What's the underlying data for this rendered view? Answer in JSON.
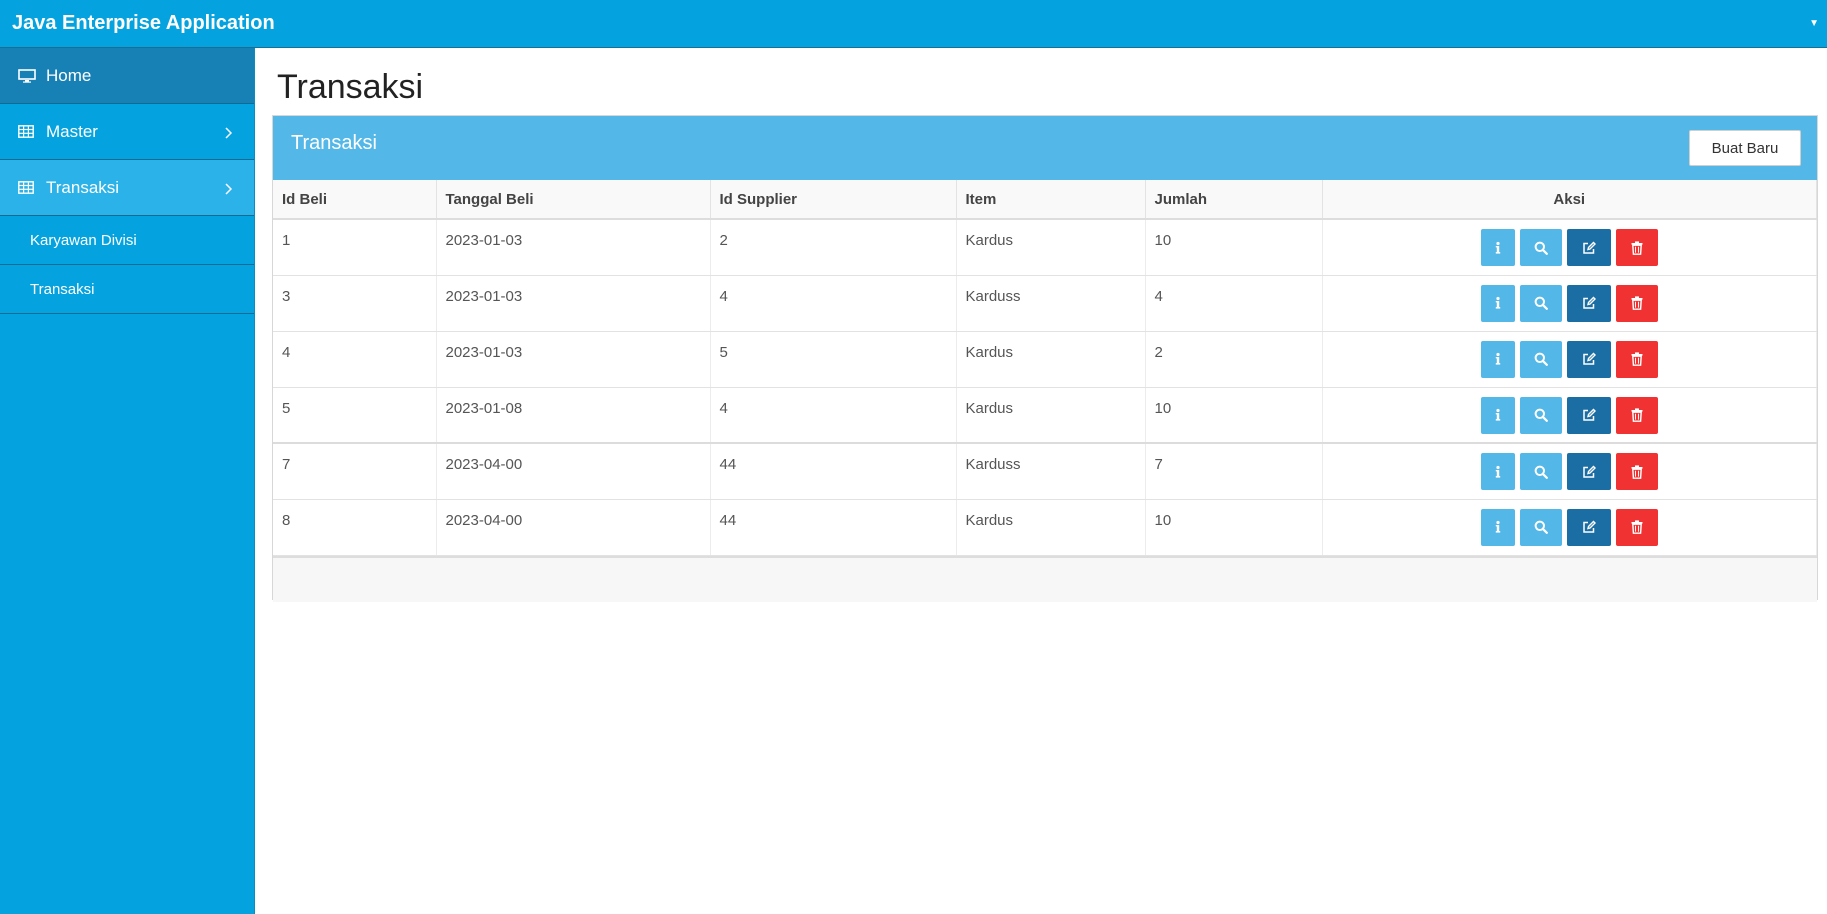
{
  "app": {
    "title": "Java Enterprise Application"
  },
  "sidebar": {
    "items": [
      {
        "label": "Home",
        "icon": "monitor-icon"
      },
      {
        "label": "Master",
        "icon": "table-icon"
      },
      {
        "label": "Transaksi",
        "icon": "table-icon"
      }
    ],
    "subitems": [
      {
        "label": "Karyawan Divisi"
      },
      {
        "label": "Transaksi"
      }
    ]
  },
  "page": {
    "title": "Transaksi"
  },
  "panel": {
    "title": "Transaksi",
    "new_button": "Buat Baru"
  },
  "table": {
    "headers": [
      "Id Beli",
      "Tanggal Beli",
      "Id Supplier",
      "Item",
      "Jumlah",
      "Aksi"
    ],
    "rows": [
      [
        "1",
        "2023-01-03",
        "2",
        "Kardus",
        "10"
      ],
      [
        "3",
        "2023-01-03",
        "4",
        "Karduss",
        "4"
      ],
      [
        "4",
        "2023-01-03",
        "5",
        "Kardus",
        "2"
      ],
      [
        "5",
        "2023-01-08",
        "4",
        "Kardus",
        "10"
      ],
      [
        "7",
        "2023-04-00",
        "44",
        "Karduss",
        "7"
      ],
      [
        "8",
        "2023-04-00",
        "44",
        "Kardus",
        "10"
      ]
    ],
    "action_icons": [
      "info-icon",
      "search-icon",
      "edit-icon",
      "trash-icon"
    ]
  },
  "colors": {
    "primary": "#04a3df",
    "panel_header": "#53b7e8",
    "edit": "#1a6ea4",
    "delete": "#f13232"
  }
}
